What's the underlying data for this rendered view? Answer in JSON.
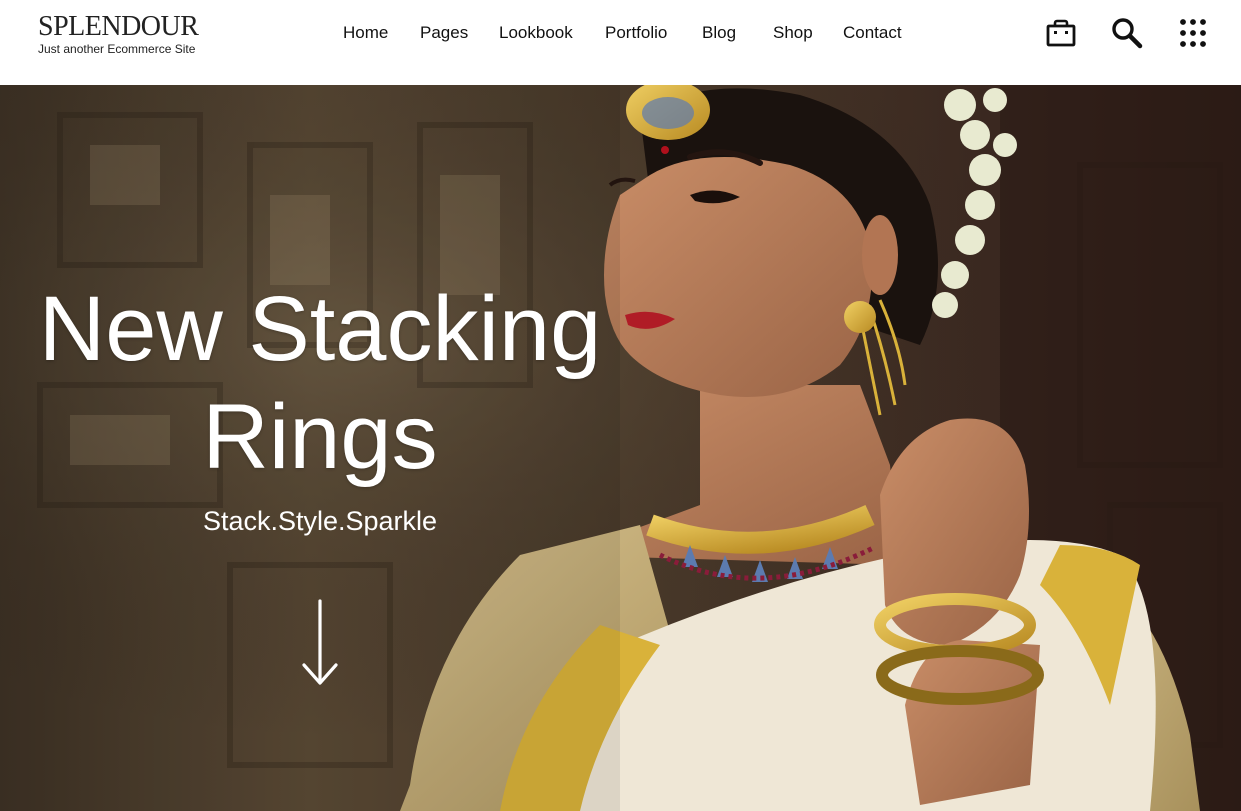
{
  "brand": {
    "name": "SPLENDOUR",
    "tagline": "Just another Ecommerce Site"
  },
  "nav": {
    "items": [
      {
        "label": "Home"
      },
      {
        "label": "Pages"
      },
      {
        "label": "Lookbook"
      },
      {
        "label": "Portfolio"
      },
      {
        "label": "Blog"
      },
      {
        "label": "Shop"
      },
      {
        "label": "Contact"
      }
    ]
  },
  "header_icons": {
    "cart": "shopping-bag-icon",
    "search": "search-icon",
    "menu": "grid-menu-icon"
  },
  "hero": {
    "title_line1": "New Stacking",
    "title_line2": "Rings",
    "subtitle": "Stack.Style.Sparkle",
    "scroll_icon": "arrow-down-icon"
  },
  "colors": {
    "header_bg": "#ffffff",
    "text_dark": "#111111",
    "hero_text": "#ffffff",
    "gold": "#d9b23a",
    "sari_cream": "#efe7d6"
  }
}
